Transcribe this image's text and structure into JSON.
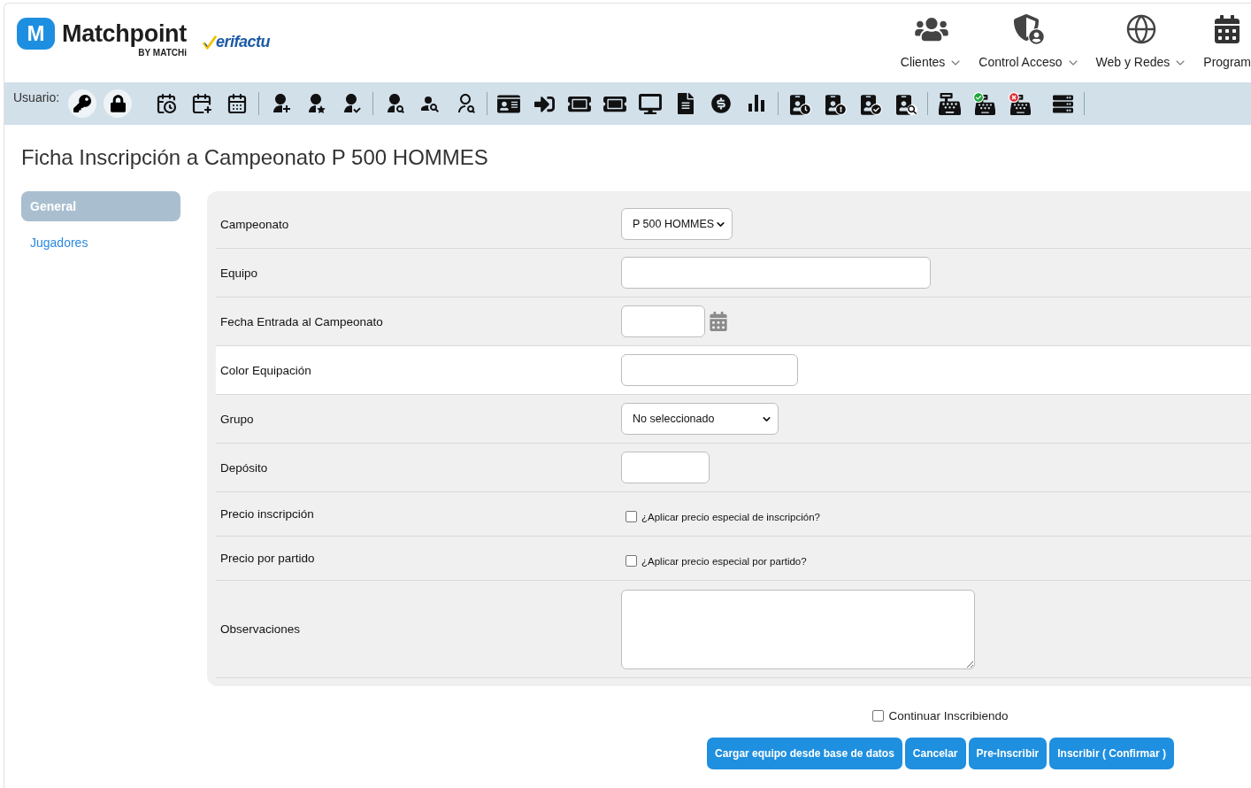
{
  "header": {
    "logo_mark": "M",
    "brand": "Matchpoint",
    "tagline": "BY MATCHi",
    "verifactu": "erifactu",
    "nav": [
      {
        "label": "Clientes",
        "dropdown": true
      },
      {
        "label": "Control Acceso",
        "dropdown": true
      },
      {
        "label": "Web y Redes",
        "dropdown": true
      },
      {
        "label": "Program",
        "dropdown": false
      }
    ]
  },
  "toolbar": {
    "label": "Usuario:"
  },
  "title": "Ficha Inscripción a Campeonato P 500 HOMMES",
  "sidebar": {
    "items": [
      {
        "label": "General",
        "selected": true
      },
      {
        "label": "Jugadores",
        "selected": false
      }
    ]
  },
  "form": {
    "rows": [
      {
        "label": "Campeonato",
        "kind": "select",
        "value": "P 500 HOMMES",
        "highlighted": false
      },
      {
        "label": "Equipo",
        "kind": "text",
        "highlighted": false
      },
      {
        "label": "Fecha Entrada al Campeonato",
        "kind": "date",
        "highlighted": false
      },
      {
        "label": "Color Equipación",
        "kind": "text",
        "highlighted": true
      },
      {
        "label": "Grupo",
        "kind": "select",
        "value": "No seleccionado",
        "highlighted": false
      },
      {
        "label": "Depósito",
        "kind": "text",
        "highlighted": false
      },
      {
        "label": "Precio inscripción",
        "kind": "checkbox",
        "option": "¿Aplicar precio especial de inscripción?",
        "checked": false,
        "highlighted": false
      },
      {
        "label": "Precio por partido",
        "kind": "checkbox",
        "option": "¿Aplicar precio especial por partido?",
        "checked": false,
        "highlighted": false
      },
      {
        "label": "Observaciones",
        "kind": "textarea",
        "highlighted": false
      }
    ]
  },
  "continue": {
    "label": "Continuar Inscribiendo",
    "checked": false
  },
  "buttons": [
    "Cargar equipo desde base de datos",
    "Cancelar",
    "Pre-Inscribir",
    "Inscribir ( Confirmar )"
  ]
}
